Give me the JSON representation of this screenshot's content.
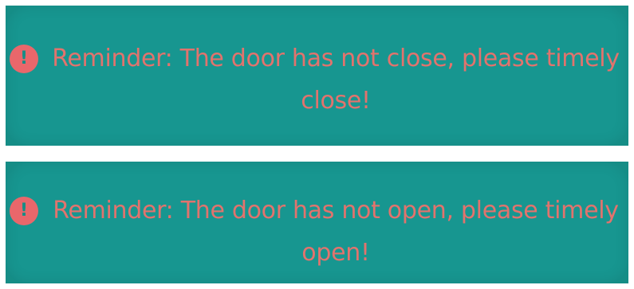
{
  "colors": {
    "banner_background": "#158d86",
    "text": "#e2736d",
    "icon": "#e9676b"
  },
  "alerts": [
    {
      "icon": "exclamation-circle-icon",
      "icon_glyph": "!",
      "message": "Reminder: The door has not close, please timely close!"
    },
    {
      "icon": "exclamation-circle-icon",
      "icon_glyph": "!",
      "message": "Reminder: The door has not open, please timely open!"
    }
  ]
}
